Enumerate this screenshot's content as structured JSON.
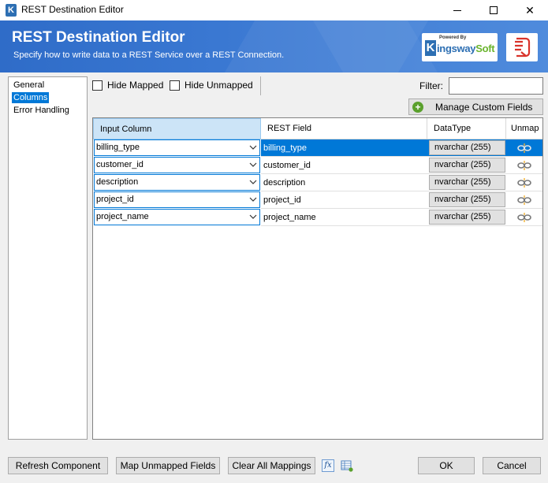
{
  "window": {
    "title": "REST Destination Editor",
    "close_glyph": "✕"
  },
  "banner": {
    "title": "REST Destination Editor",
    "subtitle": "Specify how to write data to a REST Service over a REST Connection.",
    "logo_powered": "Powered By",
    "logo_letter": "K",
    "logo_word_a": "ingsway",
    "logo_word_b": "Soft"
  },
  "nav": {
    "items": [
      {
        "label": "General",
        "selected": false
      },
      {
        "label": "Columns",
        "selected": true
      },
      {
        "label": "Error Handling",
        "selected": false
      }
    ]
  },
  "toolbar": {
    "hide_mapped": "Hide Mapped",
    "hide_unmapped": "Hide Unmapped",
    "filter_label": "Filter:",
    "filter_value": "",
    "manage_custom_fields": "Manage Custom Fields"
  },
  "grid": {
    "headers": [
      "Input Column",
      "REST Field",
      "DataType",
      "Unmap"
    ],
    "rows": [
      {
        "input": "billing_type",
        "rest": "billing_type",
        "type": "nvarchar (255)",
        "selected": true
      },
      {
        "input": "customer_id",
        "rest": "customer_id",
        "type": "nvarchar (255)",
        "selected": false
      },
      {
        "input": "description",
        "rest": "description",
        "type": "nvarchar (255)",
        "selected": false
      },
      {
        "input": "project_id",
        "rest": "project_id",
        "type": "nvarchar (255)",
        "selected": false
      },
      {
        "input": "project_name",
        "rest": "project_name",
        "type": "nvarchar (255)",
        "selected": false
      }
    ]
  },
  "footer": {
    "refresh": "Refresh Component",
    "map_unmapped": "Map Unmapped Fields",
    "clear_all": "Clear All Mappings",
    "fx": "fx",
    "ok": "OK",
    "cancel": "Cancel"
  },
  "colors": {
    "banner": "#3a78d2",
    "selection": "#0078d7",
    "header_active": "#cce4f7"
  }
}
